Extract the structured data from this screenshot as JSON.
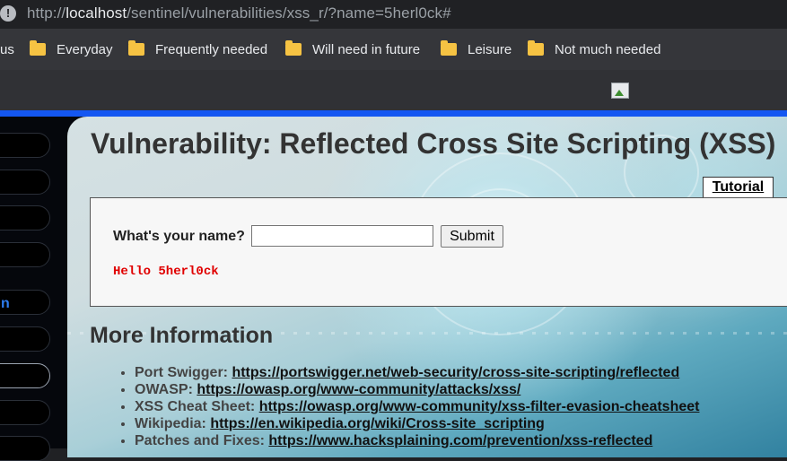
{
  "browser": {
    "url_prefix": "http://",
    "url_host": "localhost",
    "url_path": "/sentinel/vulnerabilities/xss_r/?name=5herl0ck#",
    "info_icon": "!"
  },
  "bookmarks": [
    {
      "label": "us"
    },
    {
      "label": "Everyday"
    },
    {
      "label": "Frequently needed"
    },
    {
      "label": "Will need in future"
    },
    {
      "label": "Leisure"
    },
    {
      "label": "Not much needed"
    }
  ],
  "sidebar": {
    "fragment": "n"
  },
  "main": {
    "title": "Vulnerability: Reflected Cross Site Scripting (XSS)",
    "tutorial_label": "Tutorial",
    "form": {
      "question": "What's your name?",
      "input_value": "",
      "submit_label": "Submit",
      "output": "Hello 5herl0ck"
    },
    "more_info_title": "More Information",
    "links": [
      {
        "label": "Port Swigger: ",
        "url": "https://portswigger.net/web-security/cross-site-scripting/reflected"
      },
      {
        "label": "OWASP: ",
        "url": "https://owasp.org/www-community/attacks/xss/"
      },
      {
        "label": "XSS Cheat Sheet: ",
        "url": "https://owasp.org/www-community/xss-filter-evasion-cheatsheet"
      },
      {
        "label": "Wikipedia: ",
        "url": "https://en.wikipedia.org/wiki/Cross-site_scripting"
      },
      {
        "label": "Patches and Fixes: ",
        "url": "https://www.hacksplaining.com/prevention/xss-reflected"
      }
    ]
  },
  "colors": {
    "accent_bar": "#1457f2",
    "output_text": "#e00000",
    "folder": "#f6c343"
  }
}
